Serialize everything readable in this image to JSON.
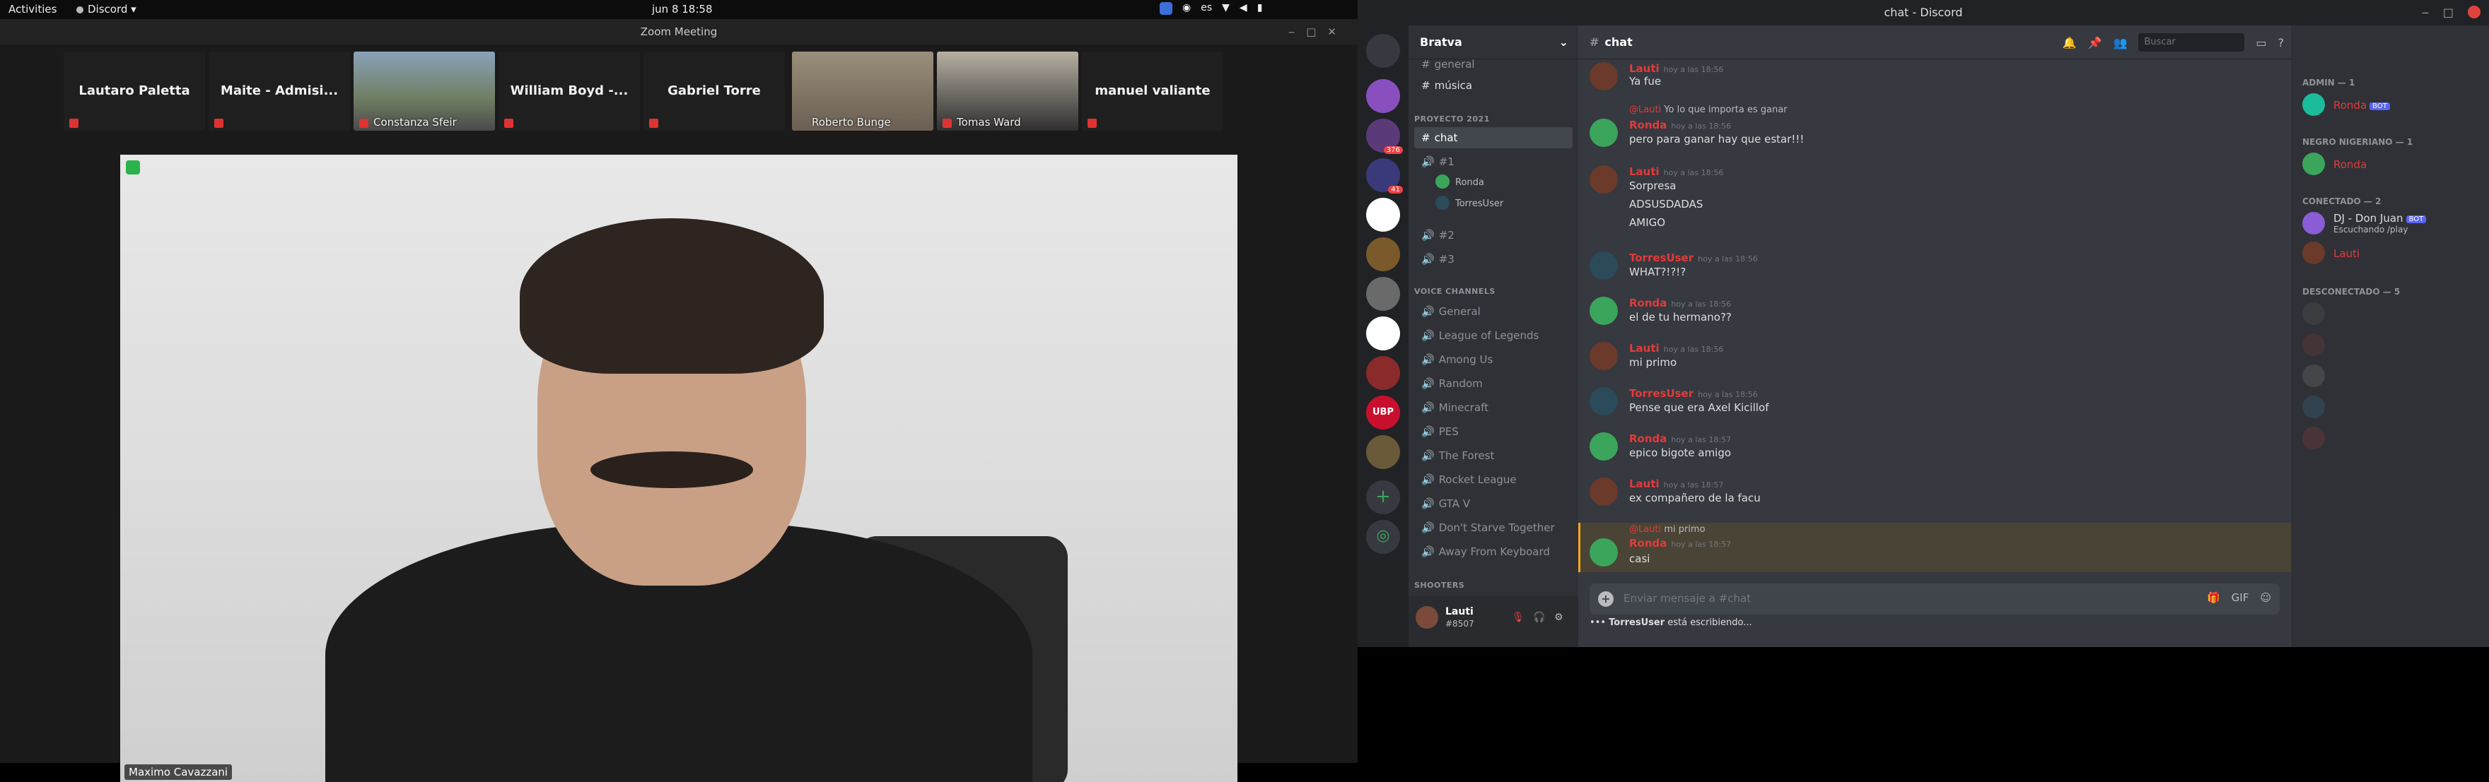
{
  "topbar": {
    "activities": "Activities",
    "app": "Discord",
    "clock": "jun 8  18:58",
    "lang": "es"
  },
  "zoom": {
    "title": "Zoom Meeting",
    "participants": [
      {
        "name": "Lautaro Paletta",
        "video": false
      },
      {
        "name": "Maite - Admisi...",
        "video": false
      },
      {
        "name": "Constanza Sfeir",
        "video": true
      },
      {
        "name": "William Boyd -...",
        "video": false
      },
      {
        "name": "Gabriel Torre",
        "video": false
      },
      {
        "name": "Roberto Bunge",
        "video": true
      },
      {
        "name": "Tomas Ward",
        "video": true
      },
      {
        "name": "manuel valiante",
        "video": false
      }
    ],
    "speaker": "Maximo Cavazzani"
  },
  "discord": {
    "window_title": "chat - Discord",
    "server": "Bratva",
    "guild_badges": [
      "376",
      "41"
    ],
    "guild_ubp": "UBP",
    "channels": {
      "top": [
        "general",
        "música"
      ],
      "cat1": "PROYECTO 2021",
      "cat1_items": [
        "chat",
        "#1"
      ],
      "voice_users": [
        "Ronda",
        "TorresUser"
      ],
      "cat1_more": [
        "#2",
        "#3"
      ],
      "cat2": "VOICE CHANNELS",
      "voice": [
        "General",
        "League of Legends",
        "Among Us",
        "Random",
        "Minecraft",
        "PES",
        "The Forest",
        "Rocket League",
        "GTA V",
        "Don't Starve Together",
        "Away From Keyboard"
      ],
      "cat3": "SHOOTERS"
    },
    "user": {
      "name": "Lauti",
      "tag": "#8507"
    },
    "chat": {
      "channel": "chat",
      "search": "Buscar",
      "messages": [
        {
          "author": "Lauti",
          "time": "hoy a las 18:56",
          "lines": [
            "Ya fue"
          ]
        },
        {
          "reply_author": "@Lauti",
          "reply": "Yo lo que importa es ganar",
          "author": "Ronda",
          "time": "hoy a las 18:56",
          "lines": [
            "pero para ganar hay que estar!!!"
          ]
        },
        {
          "author": "Lauti",
          "time": "hoy a las 18:56",
          "lines": [
            "Sorpresa",
            "ADSUSDADAS",
            "AMIGO"
          ]
        },
        {
          "author": "TorresUser",
          "time": "hoy a las 18:56",
          "lines": [
            "WHAT?!?!?"
          ]
        },
        {
          "author": "Ronda",
          "time": "hoy a las 18:56",
          "lines": [
            "el de tu hermano??"
          ]
        },
        {
          "author": "Lauti",
          "time": "hoy a las 18:56",
          "lines": [
            "mi primo"
          ]
        },
        {
          "author": "TorresUser",
          "time": "hoy a las 18:56",
          "lines": [
            "Pense que era Axel Kicillof"
          ]
        },
        {
          "author": "Ronda",
          "time": "hoy a las 18:57",
          "lines": [
            "epico bigote amigo"
          ]
        },
        {
          "author": "Lauti",
          "time": "hoy a las 18:57",
          "lines": [
            "ex compañero de la facu"
          ]
        },
        {
          "reply_author": "@Lauti",
          "reply": "mi primo",
          "author": "Ronda",
          "time": "hoy a las 18:57",
          "lines": [
            "casi"
          ]
        }
      ],
      "input_placeholder": "Enviar mensaje a #chat",
      "typing_user": "TorresUser",
      "typing_text": "está escribiendo..."
    },
    "members": {
      "admin": "ADMIN — 1",
      "admin_members": [
        {
          "name": "Ronda",
          "bot": "BOT"
        }
      ],
      "negro": "NEGRO NIGERIANO — 1",
      "negro_members": [
        {
          "name": "Ronda"
        }
      ],
      "online": "CONECTADO — 2",
      "online_members": [
        {
          "name": "DJ - Don Juan",
          "bot": "BOT",
          "status": "Escuchando /play"
        },
        {
          "name": "Lauti"
        }
      ],
      "offline": "DESCONECTADO — 5"
    }
  }
}
